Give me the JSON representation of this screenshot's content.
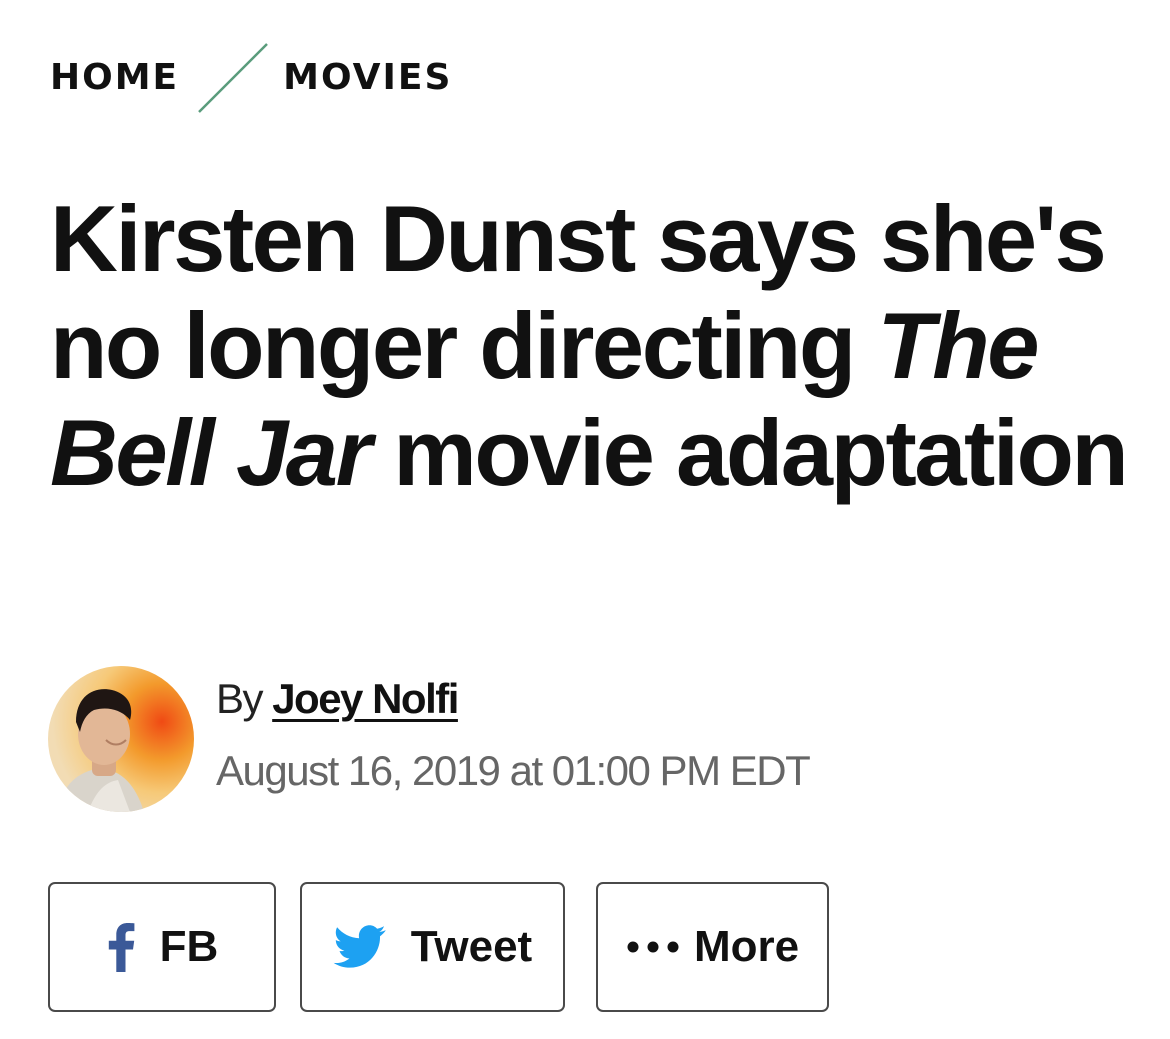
{
  "breadcrumb": {
    "home": "HOME",
    "section": "MOVIES"
  },
  "headline": {
    "part1": "Kirsten Dunst says she's no longer directing ",
    "title_italic": "The Bell Jar",
    "part2": " movie adaptation"
  },
  "byline": {
    "prefix": "By",
    "author": "Joey Nolfi",
    "date": "August 16, 2019 at 01:00 PM EDT"
  },
  "share": {
    "facebook_label": "FB",
    "twitter_label": "Tweet",
    "more_label": "More",
    "facebook_icon": "facebook-icon",
    "twitter_icon": "twitter-bird-icon",
    "more_icon": "ellipsis-icon"
  },
  "colors": {
    "breadcrumb_separator": "#5a9c7c",
    "facebook_blue": "#3b5998",
    "twitter_blue": "#1da1f2",
    "date_gray": "#666666",
    "button_border": "#4a4a4a"
  }
}
